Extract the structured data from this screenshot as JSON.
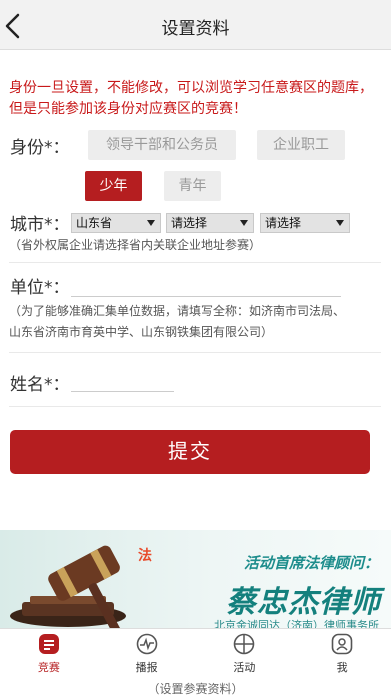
{
  "header": {
    "title": "设置资料",
    "back_icon": "chevron-left-icon"
  },
  "notice": "身份一旦设置，不能修改，可以浏览学习任意赛区的题库，但是只能参加该身份对应赛区的竞赛！",
  "identity": {
    "label": "身份*：",
    "options": [
      "领导干部和公务员",
      "企业职工",
      "少年",
      "青年"
    ],
    "selected": "少年"
  },
  "city": {
    "label": "城市*：",
    "province": "山东省",
    "city": "请选择",
    "district": "请选择",
    "hint": "（省外权属企业请选择省内关联企业地址参赛）"
  },
  "unit": {
    "label": "单位*：",
    "value": "",
    "hint_line1": "（为了能够准确汇集单位数据，请填写全称：如济南市司法局、",
    "hint_line2": "山东省济南市育英中学、山东钢铁集团有限公司）"
  },
  "name": {
    "label": "姓名*：",
    "value": ""
  },
  "submit_label": "提交",
  "banner": {
    "line1": "活动首席法律顾问：",
    "line2": "蔡忠杰律师",
    "line3": "北京金诚同达（济南）律师事务所"
  },
  "tabs": [
    {
      "label": "竞赛",
      "icon": "contest-icon",
      "active": true
    },
    {
      "label": "播报",
      "icon": "broadcast-icon",
      "active": false
    },
    {
      "label": "活动",
      "icon": "activity-icon",
      "active": false
    },
    {
      "label": "我",
      "icon": "profile-icon",
      "active": false
    }
  ],
  "colors": {
    "accent": "#b51e20",
    "notice": "#c8191a",
    "banner_text": "#14807d"
  },
  "caption": "（设置参赛资料）"
}
